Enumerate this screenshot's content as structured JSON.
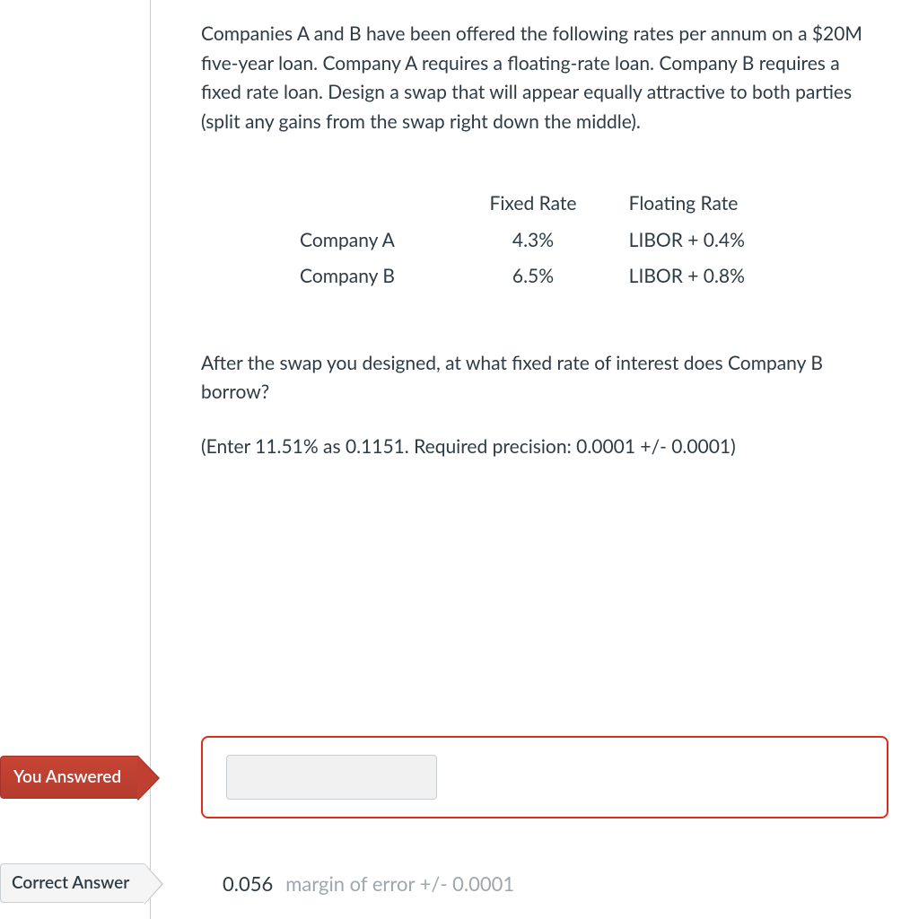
{
  "question": {
    "intro": "Companies A and B have been offered the following rates per annum on a $20M five-year loan. Company A requires a floating-rate loan. Company B requires a fixed rate loan. Design a swap that will appear equally attractive to both parties (split any gains from the swap right down the middle).",
    "followup": "After the swap you designed, at what fixed rate of interest does Company B borrow?",
    "precision": "(Enter 11.51% as 0.1151. Required precision: 0.0001 +/- 0.0001)"
  },
  "table": {
    "headers": {
      "fixed": "Fixed Rate",
      "floating": "Floating Rate"
    },
    "rows": [
      {
        "label": "Company A",
        "fixed": "4.3%",
        "floating": "LIBOR + 0.4%"
      },
      {
        "label": "Company B",
        "fixed": "6.5%",
        "floating": "LIBOR + 0.8%"
      }
    ]
  },
  "badges": {
    "you_answered": "You Answered",
    "correct_answer": "Correct Answer"
  },
  "user_answer": {
    "value": ""
  },
  "correct": {
    "value": "0.056",
    "margin_label": "margin of error +/- 0.0001"
  }
}
